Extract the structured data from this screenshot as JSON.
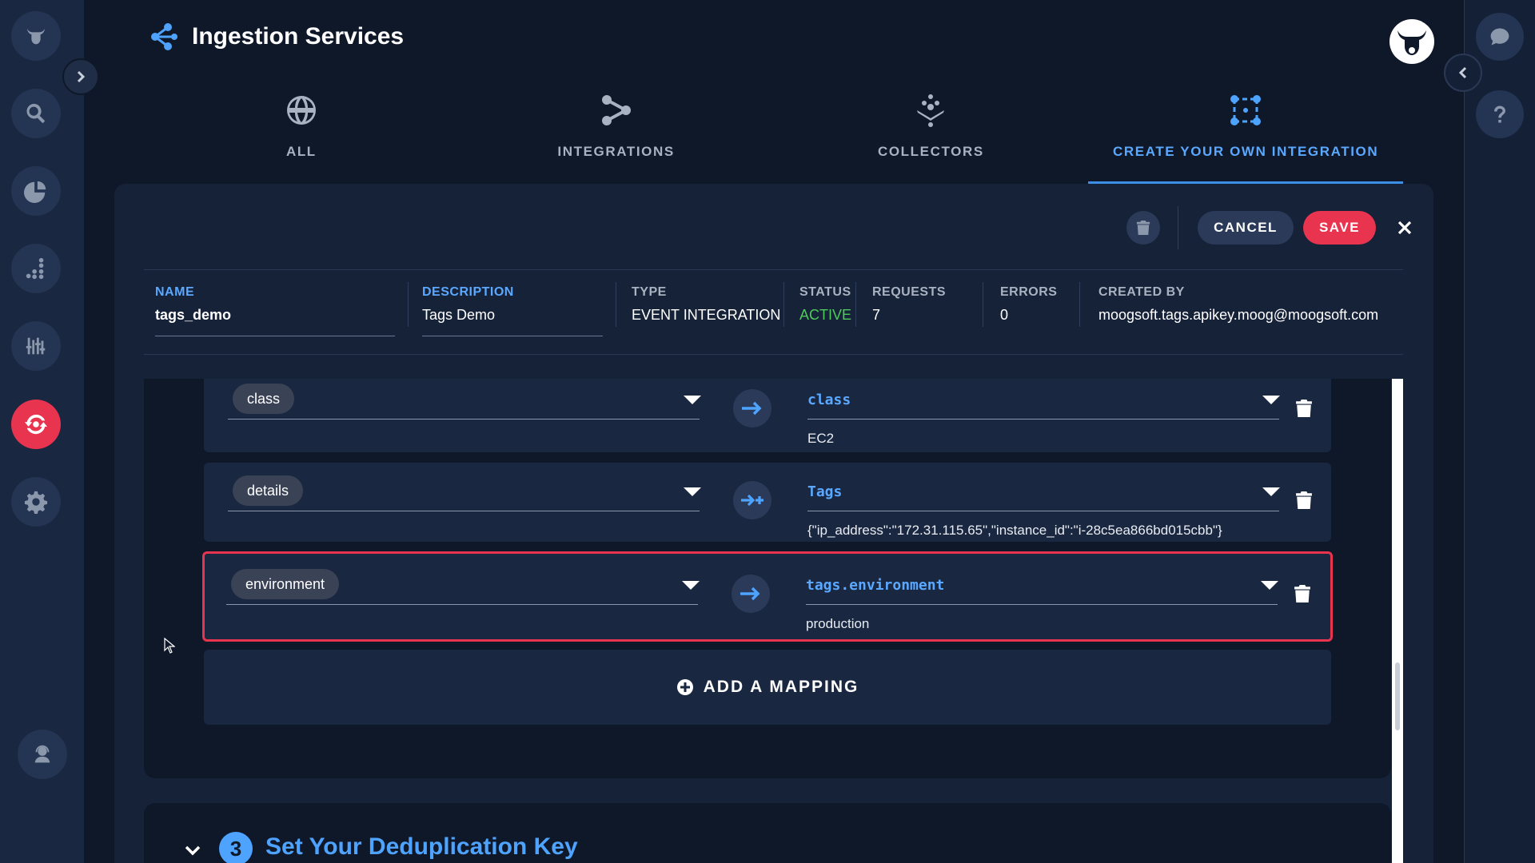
{
  "app": {
    "title": "Ingestion Services"
  },
  "tabs": [
    {
      "label": "ALL",
      "icon": "globe-icon"
    },
    {
      "label": "INTEGRATIONS",
      "icon": "share-nodes-icon"
    },
    {
      "label": "COLLECTORS",
      "icon": "collectors-icon"
    },
    {
      "label": "CREATE YOUR OWN INTEGRATION",
      "icon": "custom-integration-icon",
      "active": true
    }
  ],
  "toolbar": {
    "cancel_label": "CANCEL",
    "save_label": "SAVE"
  },
  "info": {
    "name_label": "NAME",
    "name_value": "tags_demo",
    "description_label": "DESCRIPTION",
    "description_value": "Tags Demo",
    "type_label": "TYPE",
    "type_value": "EVENT INTEGRATION",
    "status_label": "STATUS",
    "status_value": "ACTIVE",
    "requests_label": "REQUESTS",
    "requests_value": "7",
    "errors_label": "ERRORS",
    "errors_value": "0",
    "created_by_label": "CREATED BY",
    "created_by_value": "moogsoft.tags.apikey.moog@moogsoft.com"
  },
  "mappings": [
    {
      "source": "class",
      "target": "class",
      "value": "EC2",
      "arrow": "map"
    },
    {
      "source": "details",
      "target": "Tags",
      "value": "{\"ip_address\":\"172.31.115.65\",\"instance_id\":\"i-28c5ea866bd015cbb\"}",
      "arrow": "map-add"
    },
    {
      "source": "environment",
      "target": "tags.environment",
      "value": "production",
      "arrow": "map",
      "selected": true
    }
  ],
  "add_mapping_label": "ADD A MAPPING",
  "dedup": {
    "step": "3",
    "title": "Set Your Deduplication Key"
  },
  "colors": {
    "accent": "#4ea3ff",
    "danger": "#e8344f",
    "active_status": "#4fc95a",
    "background": "#0f1829"
  }
}
